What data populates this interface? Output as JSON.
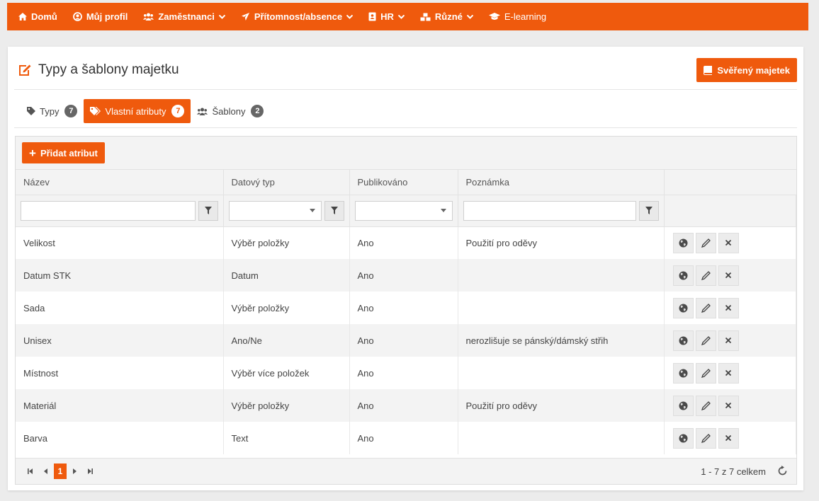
{
  "nav": {
    "items": [
      {
        "label": "Domů",
        "icon": "home-icon",
        "dropdown": false
      },
      {
        "label": "Můj profil",
        "icon": "user-circle-icon",
        "dropdown": false
      },
      {
        "label": "Zaměstnanci",
        "icon": "users-icon",
        "dropdown": true
      },
      {
        "label": "Přítomnost/absence",
        "icon": "plane-icon",
        "dropdown": true
      },
      {
        "label": "HR",
        "icon": "address-book-icon",
        "dropdown": true
      },
      {
        "label": "Různé",
        "icon": "cubes-icon",
        "dropdown": true
      },
      {
        "label": "E-learning",
        "icon": "graduation-cap-icon",
        "dropdown": false
      }
    ]
  },
  "page": {
    "title": "Typy a šablony majetku",
    "title_icon": "edit-icon",
    "top_button": "Svěřený majetek"
  },
  "tabs": [
    {
      "label": "Typy",
      "count": "7",
      "icon": "tag-icon",
      "active": false
    },
    {
      "label": "Vlastní atributy",
      "count": "7",
      "icon": "tags-icon",
      "active": true
    },
    {
      "label": "Šablony",
      "count": "2",
      "icon": "users-icon",
      "active": false
    }
  ],
  "toolbar": {
    "add_label": "Přidat atribut"
  },
  "table": {
    "columns": [
      "Název",
      "Datový typ",
      "Publikováno",
      "Poznámka",
      ""
    ],
    "rows": [
      {
        "name": "Velikost",
        "type": "Výběr položky",
        "published": "Ano",
        "note": "Použití pro oděvy"
      },
      {
        "name": "Datum STK",
        "type": "Datum",
        "published": "Ano",
        "note": ""
      },
      {
        "name": "Sada",
        "type": "Výběr položky",
        "published": "Ano",
        "note": ""
      },
      {
        "name": "Unisex",
        "type": "Ano/Ne",
        "published": "Ano",
        "note": "nerozlišuje se pánský/dámský střih"
      },
      {
        "name": "Místnost",
        "type": "Výběr více položek",
        "published": "Ano",
        "note": ""
      },
      {
        "name": "Materiál",
        "type": "Výběr položky",
        "published": "Ano",
        "note": "Použití pro oděvy"
      },
      {
        "name": "Barva",
        "type": "Text",
        "published": "Ano",
        "note": ""
      }
    ]
  },
  "pager": {
    "current_page": "1",
    "info": "1 - 7 z 7 celkem"
  },
  "colors": {
    "accent": "#ef5a0d"
  }
}
